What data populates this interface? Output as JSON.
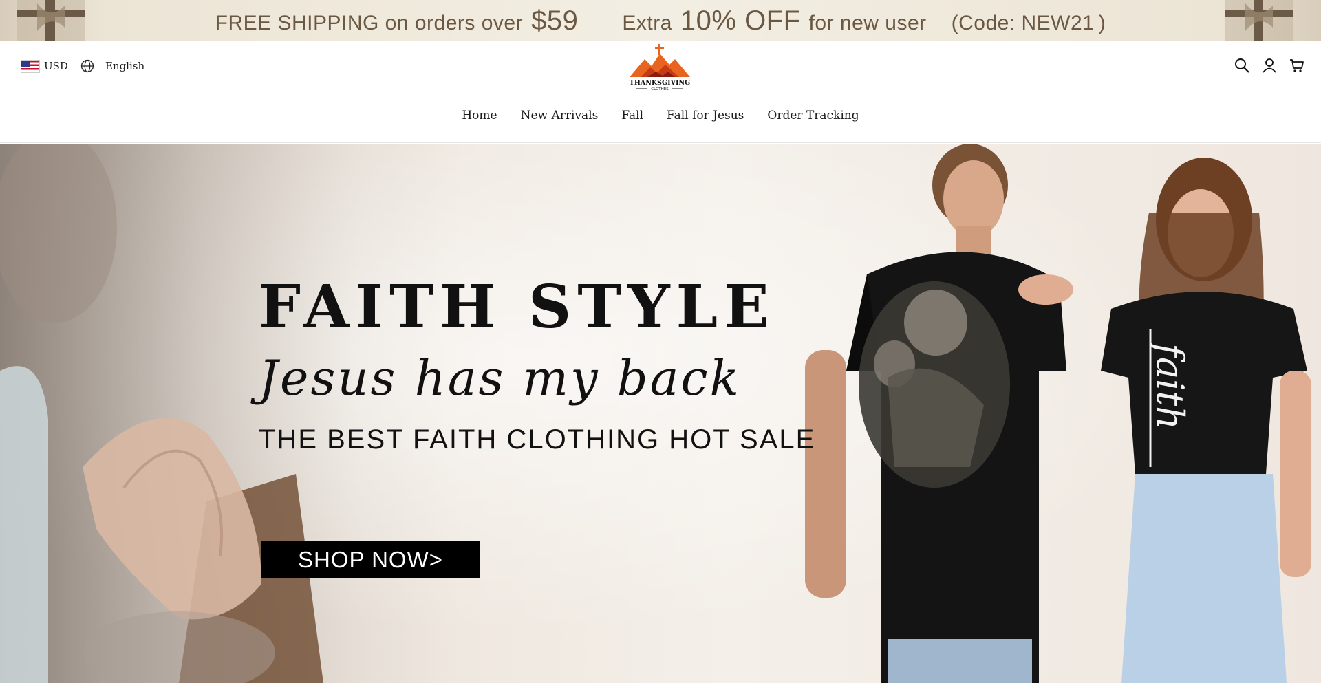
{
  "promo": {
    "shipping_prefix": "FREE SHIPPING on orders over",
    "shipping_amount": "$59",
    "extra_prefix": "Extra",
    "extra_amount": "10% OFF",
    "extra_suffix": "for new user",
    "code": "(Code: NEW21 )"
  },
  "header": {
    "currency": "USD",
    "language": "English",
    "logo": {
      "line1": "THANKSGIVING",
      "line2": "CLOTHES"
    },
    "icons": [
      "search-icon",
      "account-icon",
      "cart-icon"
    ]
  },
  "nav": {
    "items": [
      {
        "label": "Home"
      },
      {
        "label": "New Arrivals"
      },
      {
        "label": "Fall"
      },
      {
        "label": "Fall for Jesus"
      },
      {
        "label": "Order Tracking"
      }
    ]
  },
  "hero": {
    "title": "FAITH STYLE",
    "script": "Jesus has my back",
    "subtitle": "THE BEST FAITH CLOTHING HOT SALE",
    "cta": "SHOP NOW>",
    "shirt_text": "faith"
  },
  "colors": {
    "promo_text": "#6b5842",
    "logo_orange": "#e8641f",
    "cta_bg": "#000000"
  }
}
